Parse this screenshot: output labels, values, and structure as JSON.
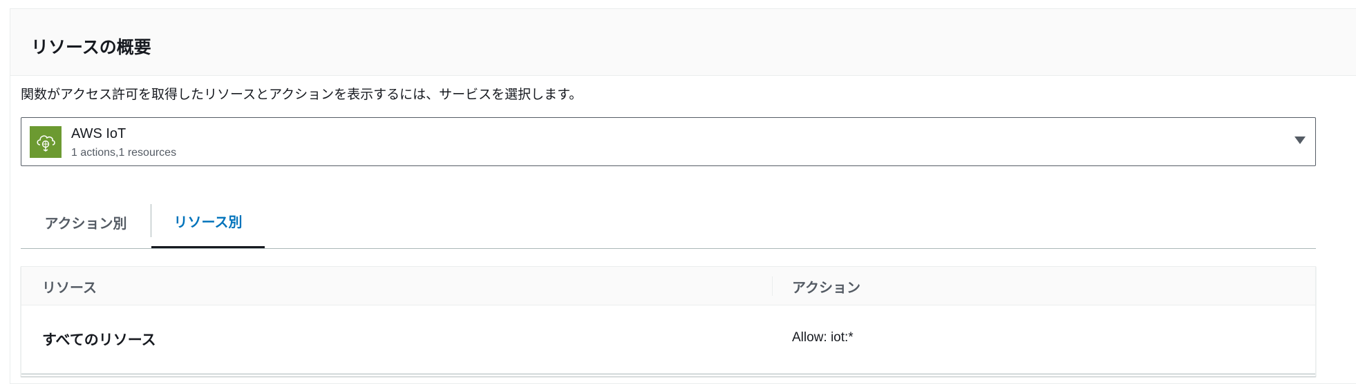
{
  "panel": {
    "title": "リソースの概要",
    "description": "関数がアクセス許可を取得したリソースとアクションを表示するには、サービスを選択します。"
  },
  "service_select": {
    "icon": "aws-iot-cloud-icon",
    "icon_color": "#6c9a31",
    "name": "AWS IoT",
    "meta": "1 actions,1 resources"
  },
  "tabs": [
    {
      "label": "アクション別",
      "selected": false
    },
    {
      "label": "リソース別",
      "selected": true
    }
  ],
  "table": {
    "columns": [
      "リソース",
      "アクション"
    ],
    "rows": [
      {
        "resource": "すべてのリソース",
        "action": "Allow: iot:*"
      }
    ]
  },
  "colors": {
    "accent": "#0073bb",
    "text": "#16191f",
    "secondary_text": "#545b64"
  }
}
